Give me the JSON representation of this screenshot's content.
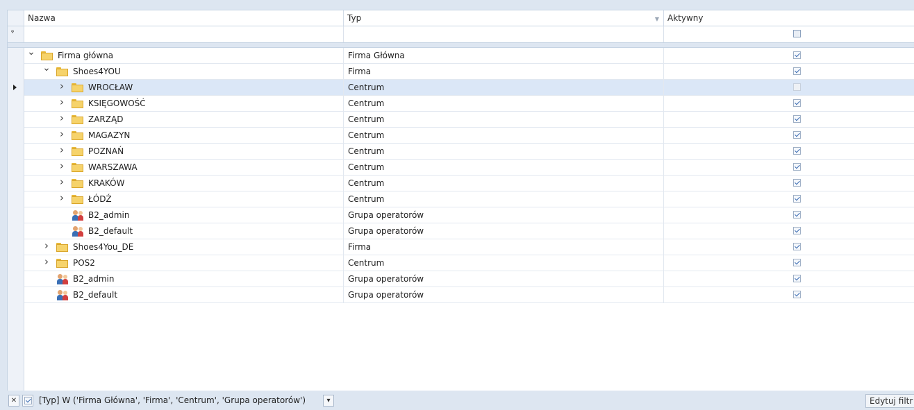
{
  "columns": {
    "name": "Nazwa",
    "type": "Typ",
    "active": "Aktywny"
  },
  "rows": [
    {
      "level": 0,
      "expander": "v",
      "icon": "folder",
      "name": "Firma główna",
      "type": "Firma Główna",
      "active": true
    },
    {
      "level": 1,
      "expander": "v",
      "icon": "folder",
      "name": "Shoes4YOU",
      "type": "Firma",
      "active": true
    },
    {
      "level": 2,
      "expander": ">",
      "icon": "folder",
      "name": "WROCŁAW",
      "type": "Centrum",
      "active": false,
      "selected": true
    },
    {
      "level": 2,
      "expander": ">",
      "icon": "folder",
      "name": "KSIĘGOWOŚĆ",
      "type": "Centrum",
      "active": true
    },
    {
      "level": 2,
      "expander": ">",
      "icon": "folder",
      "name": "ZARZĄD",
      "type": "Centrum",
      "active": true
    },
    {
      "level": 2,
      "expander": ">",
      "icon": "folder",
      "name": "MAGAZYN",
      "type": "Centrum",
      "active": true
    },
    {
      "level": 2,
      "expander": ">",
      "icon": "folder",
      "name": "POZNAŃ",
      "type": "Centrum",
      "active": true
    },
    {
      "level": 2,
      "expander": ">",
      "icon": "folder",
      "name": "WARSZAWA",
      "type": "Centrum",
      "active": true
    },
    {
      "level": 2,
      "expander": ">",
      "icon": "folder",
      "name": "KRAKÓW",
      "type": "Centrum",
      "active": true
    },
    {
      "level": 2,
      "expander": ">",
      "icon": "folder",
      "name": "ŁÓDŹ",
      "type": "Centrum",
      "active": true
    },
    {
      "level": 2,
      "expander": "",
      "icon": "users",
      "name": "B2_admin",
      "type": "Grupa operatorów",
      "active": true
    },
    {
      "level": 2,
      "expander": "",
      "icon": "users",
      "name": "B2_default",
      "type": "Grupa operatorów",
      "active": true
    },
    {
      "level": 1,
      "expander": ">",
      "icon": "folder",
      "name": "Shoes4You_DE",
      "type": "Firma",
      "active": true
    },
    {
      "level": 1,
      "expander": ">",
      "icon": "folder",
      "name": "POS2",
      "type": "Centrum",
      "active": true
    },
    {
      "level": 1,
      "expander": "",
      "icon": "users",
      "name": "B2_admin",
      "type": "Grupa operatorów",
      "active": true
    },
    {
      "level": 1,
      "expander": "",
      "icon": "users",
      "name": "B2_default",
      "type": "Grupa operatorów",
      "active": true
    }
  ],
  "filter": {
    "enabled": true,
    "text": "[Typ] W ('Firma Główna', 'Firma', 'Centrum', 'Grupa operatorów')",
    "edit_label": "Edytuj filtr"
  }
}
